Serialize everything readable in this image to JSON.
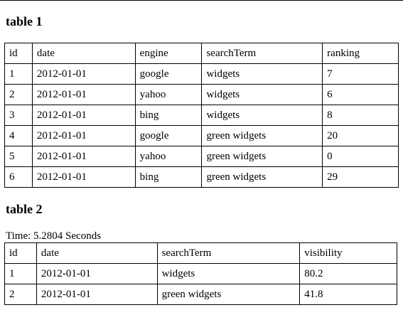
{
  "table1": {
    "title": "table 1",
    "headers": [
      "id",
      "date",
      "engine",
      "searchTerm",
      "ranking"
    ],
    "rows": [
      [
        "1",
        "2012-01-01",
        "google",
        "widgets",
        "7"
      ],
      [
        "2",
        "2012-01-01",
        "yahoo",
        "widgets",
        "6"
      ],
      [
        "3",
        "2012-01-01",
        "bing",
        "widgets",
        "8"
      ],
      [
        "4",
        "2012-01-01",
        "google",
        "green widgets",
        "20"
      ],
      [
        "5",
        "2012-01-01",
        "yahoo",
        "green widgets",
        "0"
      ],
      [
        "6",
        "2012-01-01",
        "bing",
        "green widgets",
        "29"
      ]
    ]
  },
  "table2": {
    "title": "table 2",
    "caption": "Time: 5.2804 Seconds",
    "headers": [
      "id",
      "date",
      "searchTerm",
      "visibility"
    ],
    "rows": [
      [
        "1",
        "2012-01-01",
        "widgets",
        "80.2"
      ],
      [
        "2",
        "2012-01-01",
        "green widgets",
        "41.8"
      ]
    ]
  }
}
